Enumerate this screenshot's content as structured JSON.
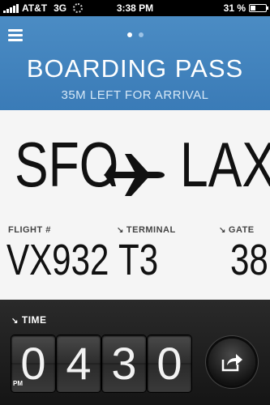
{
  "status_bar": {
    "carrier": "AT&T",
    "network": "3G",
    "time": "3:38 PM",
    "battery": "31 %",
    "battery_level": 0.31
  },
  "header": {
    "title": "BOARDING PASS",
    "subtitle": "35M LEFT FOR ARRIVAL",
    "page_dots": 2,
    "active_dot": 0
  },
  "route": {
    "from": "SFO",
    "to": "LAX",
    "icon": "airplane-icon"
  },
  "details": {
    "flight_label": "FLIGHT #",
    "flight_value": "VX932",
    "terminal_label": "TERMINAL",
    "terminal_value": "T3",
    "gate_label": "GATE",
    "gate_value": "38"
  },
  "time": {
    "label": "TIME",
    "digits": [
      "0",
      "4",
      "3",
      "0"
    ],
    "ampm": "PM"
  },
  "colors": {
    "header_blue": "#3f82bd",
    "card_bg": "#f5f5f5",
    "bottom_dark": "#1b1b1b"
  }
}
